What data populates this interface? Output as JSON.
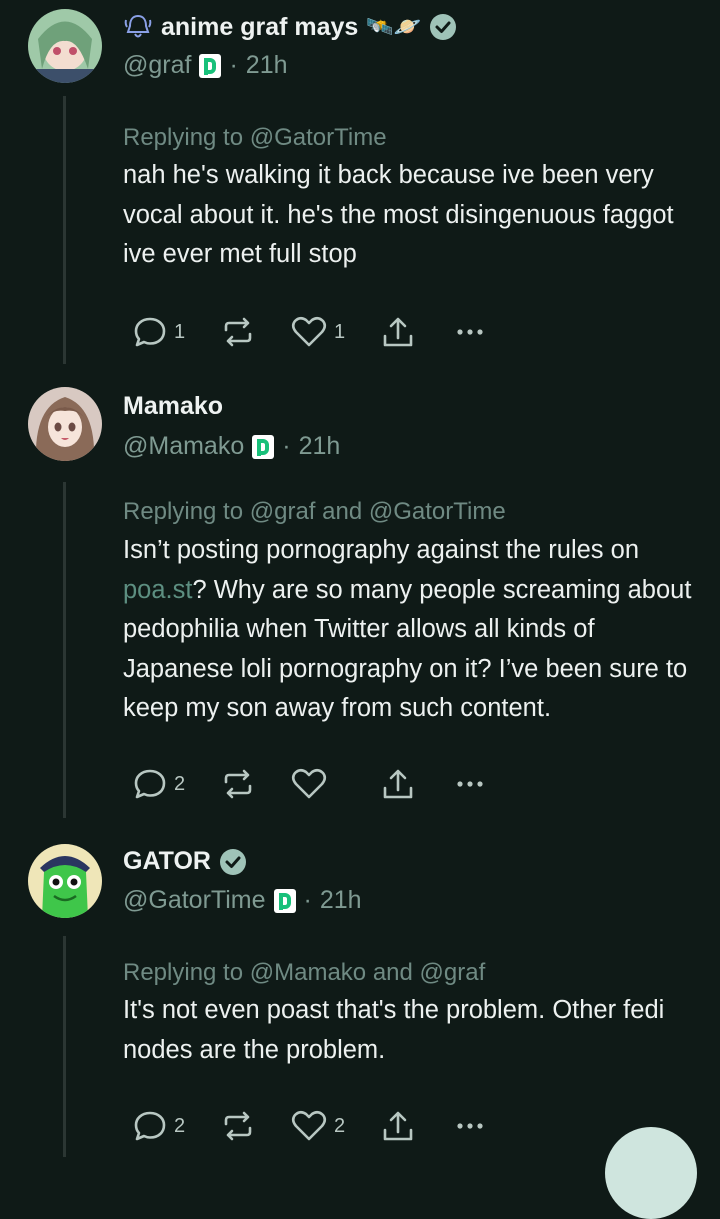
{
  "posts": [
    {
      "name": "anime graf mays",
      "name_emoji": "🛰️🪐",
      "handle": "@graf",
      "time": "21h",
      "verified": true,
      "reply_prefix": "Replying to",
      "reply_mentions": [
        "@GatorTime"
      ],
      "reply_joiner": "",
      "body": "nah he's walking it back because ive been very vocal about it. he's the most disingenuous faggot ive ever met full stop",
      "replies": "1",
      "reposts": "",
      "likes": "1"
    },
    {
      "name": "Mamako",
      "handle": "@Mamako",
      "time": "21h",
      "verified": false,
      "reply_prefix": "Replying to",
      "reply_mentions": [
        "@graf",
        "@GatorTime"
      ],
      "reply_joiner": "and",
      "body_pre": "Isn’t posting pornography against the rules on ",
      "body_link": "poa.st",
      "body_post": "? Why are so many people screaming about pedophilia when Twitter allows all kinds of Japanese loli pornography on it? I’ve been sure to keep my son away from such content.",
      "replies": "2",
      "reposts": "",
      "likes": ""
    },
    {
      "name": "GATOR",
      "handle": "@GatorTime",
      "time": "21h",
      "verified": true,
      "reply_prefix": "Replying to",
      "reply_mentions": [
        "@Mamako",
        "@graf"
      ],
      "reply_joiner": "and",
      "body": "It's not even poast that's the problem. Other fedi nodes are the problem.",
      "replies": "2",
      "reposts": "",
      "likes": "2"
    }
  ],
  "separator": "·",
  "colors": {
    "background": "#0f1a17",
    "muted": "#7f9a92",
    "link": "#5d8f81",
    "verified": "#9fc3b8",
    "poast_green": "#18c07a"
  },
  "icons": [
    "reply-icon",
    "repost-icon",
    "like-icon",
    "share-icon",
    "more-icon",
    "verified-icon",
    "poast-icon"
  ]
}
